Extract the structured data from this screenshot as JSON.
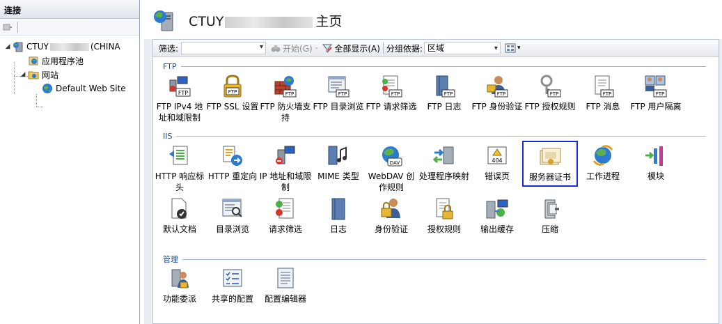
{
  "connections": {
    "title": "连接",
    "tree": {
      "server_prefix": "CTUY",
      "server_suffix": "(CHINA",
      "app_pools": "应用程序池",
      "sites": "网站",
      "default_site": "Default Web Site"
    }
  },
  "header": {
    "title_prefix": "CTUY",
    "title_suffix": "主页"
  },
  "filter_bar": {
    "filter_label": "筛选:",
    "filter_value": "",
    "go_label": "开始(G)",
    "show_all_label": "全部显示(A)",
    "group_by_label": "分组依据:",
    "group_by_value": "区域"
  },
  "groups": {
    "ftp": {
      "label": "FTP",
      "items": [
        {
          "label": "FTP IPv4 地址和域限制",
          "icon": "ftp-ipv4-restrictions-icon"
        },
        {
          "label": "FTP SSL 设置",
          "icon": "ftp-ssl-settings-icon"
        },
        {
          "label": "FTP 防火墙支持",
          "icon": "ftp-firewall-icon"
        },
        {
          "label": "FTP 目录浏览",
          "icon": "ftp-directory-browsing-icon"
        },
        {
          "label": "FTP 请求筛选",
          "icon": "ftp-request-filtering-icon"
        },
        {
          "label": "FTP 日志",
          "icon": "ftp-logging-icon"
        },
        {
          "label": "FTP 身份验证",
          "icon": "ftp-authentication-icon"
        },
        {
          "label": "FTP 授权规则",
          "icon": "ftp-authorization-icon"
        },
        {
          "label": "FTP 消息",
          "icon": "ftp-messages-icon"
        },
        {
          "label": "FTP 用户隔离",
          "icon": "ftp-user-isolation-icon"
        }
      ]
    },
    "iis": {
      "label": "IIS",
      "items": [
        {
          "label": "HTTP 响应标头",
          "icon": "http-response-headers-icon"
        },
        {
          "label": "HTTP 重定向",
          "icon": "http-redirect-icon"
        },
        {
          "label": "IP 地址和域限制",
          "icon": "ip-restrictions-icon"
        },
        {
          "label": "MIME 类型",
          "icon": "mime-types-icon"
        },
        {
          "label": "WebDAV 创作规则",
          "icon": "webdav-icon"
        },
        {
          "label": "处理程序映射",
          "icon": "handler-mappings-icon"
        },
        {
          "label": "错误页",
          "icon": "error-pages-icon",
          "badge": "404"
        },
        {
          "label": "服务器证书",
          "icon": "server-certificates-icon"
        },
        {
          "label": "工作进程",
          "icon": "worker-processes-icon"
        },
        {
          "label": "模块",
          "icon": "modules-icon"
        },
        {
          "label": "默认文档",
          "icon": "default-document-icon"
        },
        {
          "label": "目录浏览",
          "icon": "directory-browsing-icon"
        },
        {
          "label": "请求筛选",
          "icon": "request-filtering-icon"
        },
        {
          "label": "日志",
          "icon": "logging-icon"
        },
        {
          "label": "身份验证",
          "icon": "authentication-icon"
        },
        {
          "label": "授权规则",
          "icon": "authorization-rules-icon"
        },
        {
          "label": "输出缓存",
          "icon": "output-caching-icon"
        },
        {
          "label": "压缩",
          "icon": "compression-icon"
        }
      ]
    },
    "management": {
      "label": "管理",
      "items": [
        {
          "label": "功能委派",
          "icon": "feature-delegation-icon"
        },
        {
          "label": "共享的配置",
          "icon": "shared-configuration-icon"
        },
        {
          "label": "配置编辑器",
          "icon": "configuration-editor-icon"
        }
      ]
    }
  },
  "selected_item": "服务器证书",
  "colors": {
    "selection_border": "#1b2bd8",
    "group_header": "#1d4a91",
    "main_background": "#e9eef5"
  }
}
